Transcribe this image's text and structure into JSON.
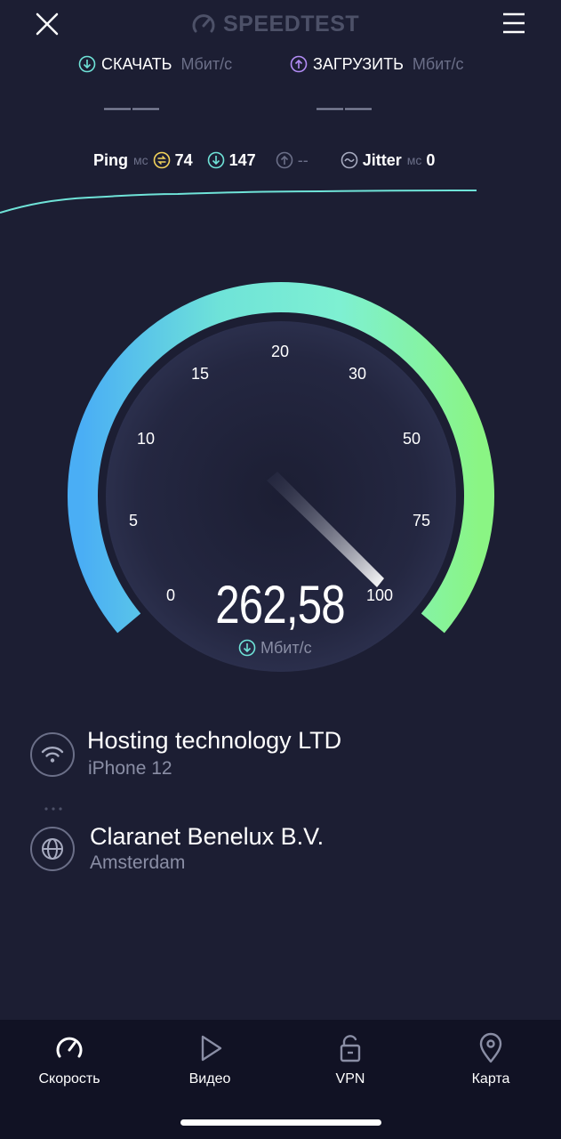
{
  "header": {
    "logo_text": "SPEEDTEST",
    "close_icon": "close-icon",
    "menu_icon": "hamburger-menu-icon"
  },
  "download": {
    "label": "СКАЧАТЬ",
    "unit": "Мбит/с",
    "value": "——"
  },
  "upload": {
    "label": "ЗАГРУЗИТЬ",
    "unit": "Мбит/с",
    "value": "——"
  },
  "ping": {
    "label": "Ping",
    "unit": "мс",
    "idle": "74",
    "download": "147",
    "upload": "--",
    "jitter_label": "Jitter",
    "jitter_unit": "мс",
    "jitter": "0"
  },
  "gauge": {
    "ticks": [
      "0",
      "5",
      "10",
      "15",
      "20",
      "30",
      "50",
      "75",
      "100"
    ],
    "value": "262,58",
    "unit": "Мбит/с",
    "needle_level_fraction": 1.0
  },
  "connection": {
    "isp_name": "Hosting technology LTD",
    "device": "iPhone 12",
    "server_name": "Claranet Benelux B.V.",
    "server_location": "Amsterdam"
  },
  "tabs": [
    {
      "label": "Скорость",
      "icon": "speedometer-icon",
      "active": true
    },
    {
      "label": "Видео",
      "icon": "play-icon",
      "active": false
    },
    {
      "label": "VPN",
      "icon": "lock-icon",
      "active": false
    },
    {
      "label": "Карта",
      "icon": "map-pin-icon",
      "active": false
    }
  ],
  "colors": {
    "background": "#1c1e33",
    "download_accent": "#6fe3d8",
    "upload_accent": "#b28cf5",
    "gauge_start": "#4aaef5",
    "gauge_mid": "#7ef0d2",
    "gauge_end": "#8af584",
    "tab_bar": "#111224"
  }
}
